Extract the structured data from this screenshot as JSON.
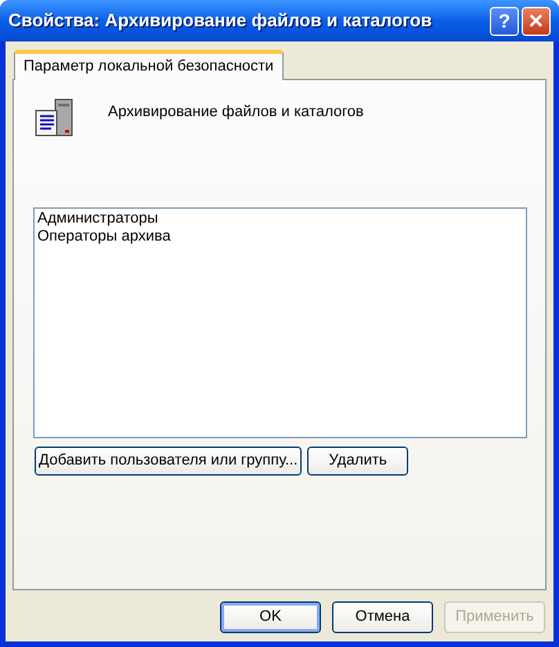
{
  "window": {
    "title": "Свойства: Архивирование файлов и каталогов"
  },
  "title_buttons": [
    {
      "kind": "help",
      "label": "?"
    },
    {
      "kind": "close",
      "label": "✕"
    }
  ],
  "tabs": [
    {
      "label": "Параметр локальной безопасности",
      "selected": true
    }
  ],
  "policy": {
    "name": "Архивирование файлов и каталогов"
  },
  "members": [
    {
      "name": "Администраторы"
    },
    {
      "name": "Операторы архива"
    }
  ],
  "member_buttons": [
    {
      "label": "Добавить пользователя или группу..."
    },
    {
      "label": "Удалить"
    }
  ],
  "buttons": [
    {
      "label": "OK",
      "default": true,
      "disabled": false
    },
    {
      "label": "Отмена",
      "default": false,
      "disabled": false
    },
    {
      "label": "Применить",
      "default": false,
      "disabled": true
    }
  ]
}
